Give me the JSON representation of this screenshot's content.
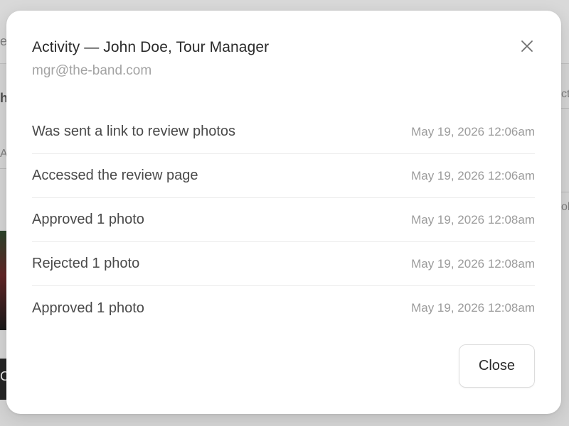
{
  "background": {
    "fragments": [
      "e",
      "h",
      "A",
      "C",
      "ct",
      "ol"
    ]
  },
  "dialog": {
    "title": "Activity — John Doe, Tour Manager",
    "subtitle": "mgr@the-band.com",
    "close_icon": "close-icon",
    "activities": [
      {
        "text": "Was sent a link to review photos",
        "time": "May 19, 2026 12:06am"
      },
      {
        "text": "Accessed the review page",
        "time": "May 19, 2026 12:06am"
      },
      {
        "text": "Approved 1 photo",
        "time": "May 19, 2026 12:08am"
      },
      {
        "text": "Rejected 1 photo",
        "time": "May 19, 2026 12:08am"
      },
      {
        "text": "Approved 1 photo",
        "time": "May 19, 2026 12:08am"
      }
    ],
    "close_label": "Close"
  },
  "colors": {
    "text_primary": "#2b2b2b",
    "text_secondary": "#a3a3a3",
    "timestamp": "#9b9b9b",
    "divider": "#ececec"
  }
}
